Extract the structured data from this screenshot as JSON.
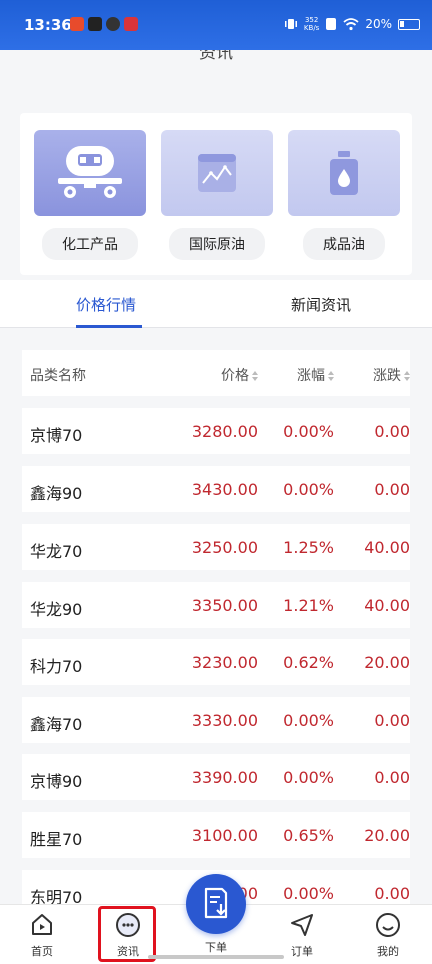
{
  "status": {
    "time": "13:36",
    "net_speed_value": "352",
    "net_speed_unit": "KB/s",
    "battery": "20%"
  },
  "header": {
    "title": "资讯"
  },
  "categories": [
    {
      "label": "化工产品",
      "icon": "tanker-truck-icon"
    },
    {
      "label": "国际原油",
      "icon": "oil-chart-icon"
    },
    {
      "label": "成品油",
      "icon": "oil-canister-icon"
    }
  ],
  "tabs": [
    {
      "label": "价格行情",
      "active": true
    },
    {
      "label": "新闻资讯",
      "active": false
    }
  ],
  "table": {
    "headers": {
      "name": "品类名称",
      "price": "价格",
      "pct": "涨幅",
      "chg": "涨跌"
    },
    "rows": [
      {
        "name": "京博70",
        "price": "3280.00",
        "pct": "0.00%",
        "chg": "0.00"
      },
      {
        "name": "鑫海90",
        "price": "3430.00",
        "pct": "0.00%",
        "chg": "0.00"
      },
      {
        "name": "华龙70",
        "price": "3250.00",
        "pct": "1.25%",
        "chg": "40.00"
      },
      {
        "name": "华龙90",
        "price": "3350.00",
        "pct": "1.21%",
        "chg": "40.00"
      },
      {
        "name": "科力70",
        "price": "3230.00",
        "pct": "0.62%",
        "chg": "20.00"
      },
      {
        "name": "鑫海70",
        "price": "3330.00",
        "pct": "0.00%",
        "chg": "0.00"
      },
      {
        "name": "京博90",
        "price": "3390.00",
        "pct": "0.00%",
        "chg": "0.00"
      },
      {
        "name": "胜星70",
        "price": "3100.00",
        "pct": "0.65%",
        "chg": "20.00"
      },
      {
        "name": "东明70",
        "price": "00",
        "pct": "0.00%",
        "chg": "0.00"
      }
    ]
  },
  "nav": [
    {
      "label": "首页",
      "icon": "home-icon"
    },
    {
      "label": "资讯",
      "icon": "news-icon",
      "active": true
    },
    {
      "label": "下单",
      "icon": "place-order-icon"
    },
    {
      "label": "订单",
      "icon": "send-icon"
    },
    {
      "label": "我的",
      "icon": "profile-icon"
    }
  ],
  "colors": {
    "accent": "#2a58d1",
    "price_red": "#c0282f",
    "highlight_red": "#e0121e",
    "status_blue": "#1f5fd6"
  }
}
